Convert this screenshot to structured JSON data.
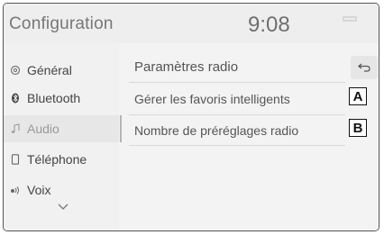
{
  "header": {
    "title": "Configuration",
    "time": "9:08"
  },
  "sidebar": {
    "items": [
      {
        "label": "Général",
        "icon": "gear-icon"
      },
      {
        "label": "Bluetooth",
        "icon": "bluetooth-icon"
      },
      {
        "label": "Audio",
        "icon": "music-note-icon",
        "active": true
      },
      {
        "label": "Téléphone",
        "icon": "phone-icon"
      },
      {
        "label": "Voix",
        "icon": "voice-icon"
      }
    ],
    "more_icon": "chevron-down-icon"
  },
  "content": {
    "title": "Paramètres radio",
    "back_icon": "back-arrow-icon",
    "rows": [
      {
        "label": "Gérer les favoris intelligents",
        "callout": "A"
      },
      {
        "label": "Nombre de préréglages radio",
        "callout": "B"
      }
    ]
  },
  "colors": {
    "background": "#f3f3f3",
    "text": "#555555",
    "active_text": "#9a9a9a",
    "callout_border": "#111111"
  }
}
